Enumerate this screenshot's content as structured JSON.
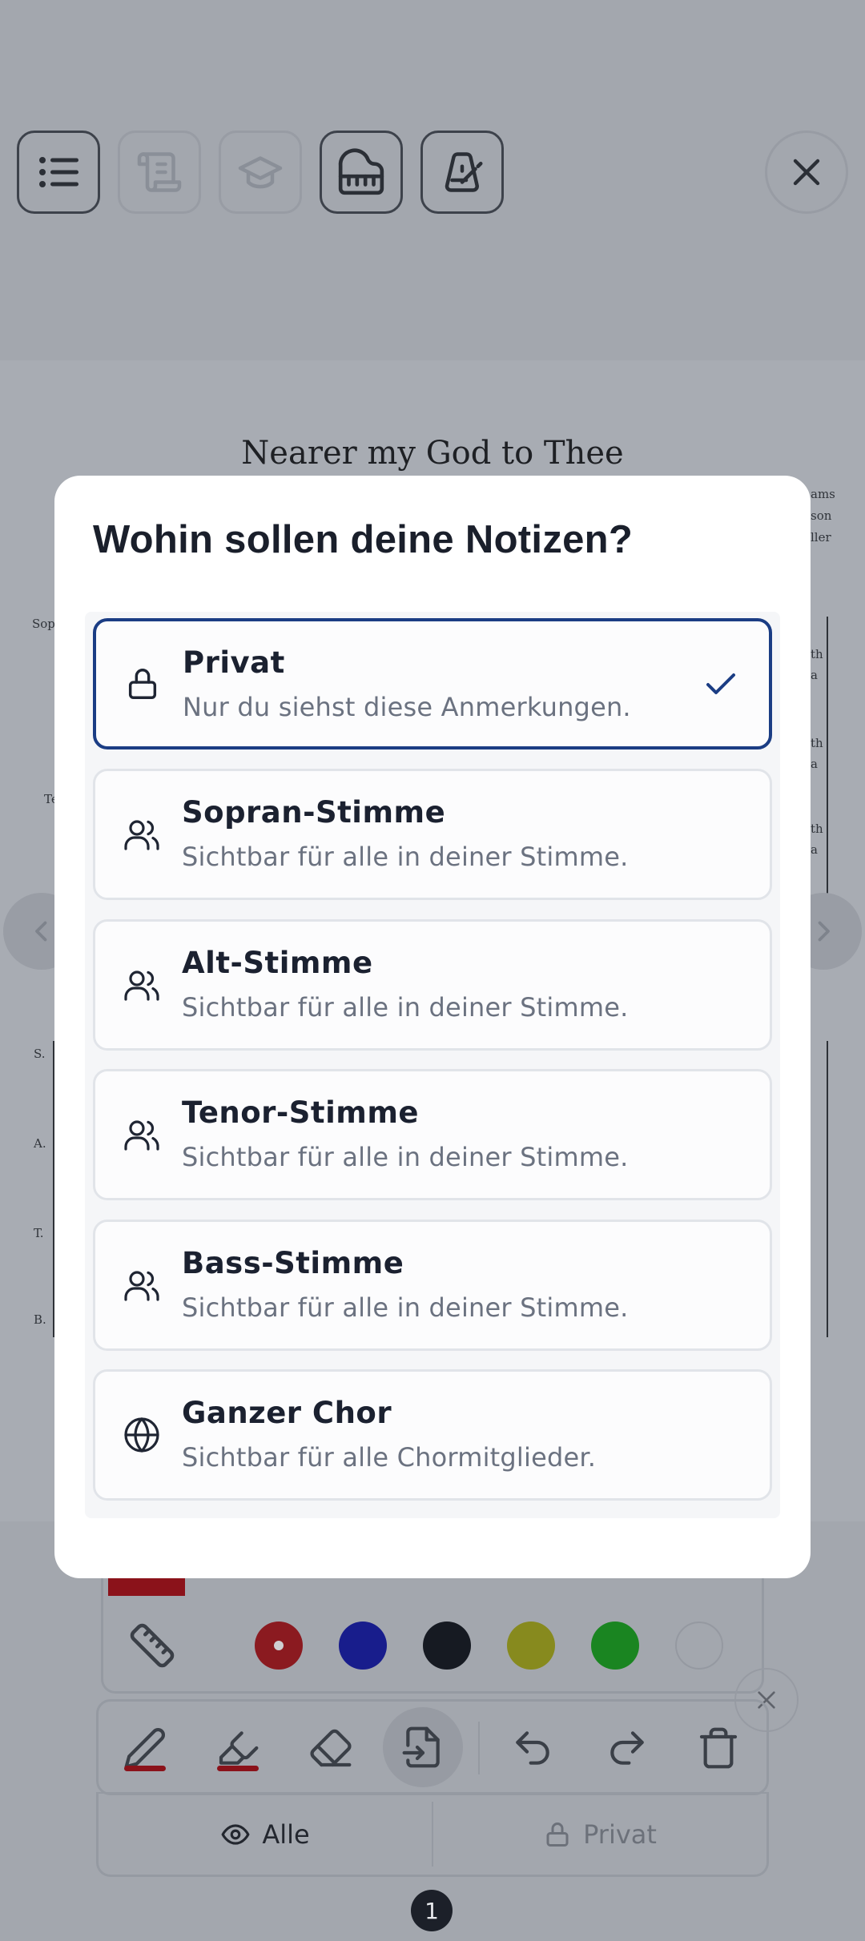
{
  "top_toolbar": {
    "buttons": [
      {
        "name": "list",
        "state": "active"
      },
      {
        "name": "scroll",
        "state": "inactive"
      },
      {
        "name": "graduation-cap",
        "state": "inactive"
      },
      {
        "name": "piano",
        "state": "active"
      },
      {
        "name": "metronome",
        "state": "active"
      }
    ],
    "close_icon": "close-icon"
  },
  "sheet": {
    "title": "Nearer my God to Thee",
    "credits": [
      "ams",
      "son",
      "ller"
    ],
    "part_labels_top": [
      "Sopr",
      "Te"
    ],
    "part_labels_bottom": [
      "S.",
      "A.",
      "T.",
      "B."
    ],
    "lyric_fragments": [
      "th",
      "a",
      "th",
      "a",
      "th",
      "a"
    ]
  },
  "annotation_toolbar": {
    "colors": [
      "#b51d24",
      "#1c22b8",
      "#1a1f29",
      "#b0b11c",
      "#18a91e",
      "#ffffff"
    ],
    "selected_color": "#b51d24",
    "tools": [
      "pencil",
      "highlighter",
      "eraser",
      "export",
      "undo",
      "redo",
      "trash"
    ],
    "mode_all_label": "Alle",
    "mode_private_label": "Privat",
    "page_number": "1"
  },
  "modal": {
    "title": "Wohin sollen deine Notizen?",
    "options": [
      {
        "icon": "lock-icon",
        "title": "Privat",
        "description": "Nur du siehst diese Anmerkungen.",
        "selected": true
      },
      {
        "icon": "users-icon",
        "title": "Sopran-Stimme",
        "description": "Sichtbar für alle in deiner Stimme.",
        "selected": false
      },
      {
        "icon": "users-icon",
        "title": "Alt-Stimme",
        "description": "Sichtbar für alle in deiner Stimme.",
        "selected": false
      },
      {
        "icon": "users-icon",
        "title": "Tenor-Stimme",
        "description": "Sichtbar für alle in deiner Stimme.",
        "selected": false
      },
      {
        "icon": "users-icon",
        "title": "Bass-Stimme",
        "description": "Sichtbar für alle in deiner Stimme.",
        "selected": false
      },
      {
        "icon": "globe-icon",
        "title": "Ganzer Chor",
        "description": "Sichtbar für alle Chormitglieder.",
        "selected": false
      }
    ]
  }
}
